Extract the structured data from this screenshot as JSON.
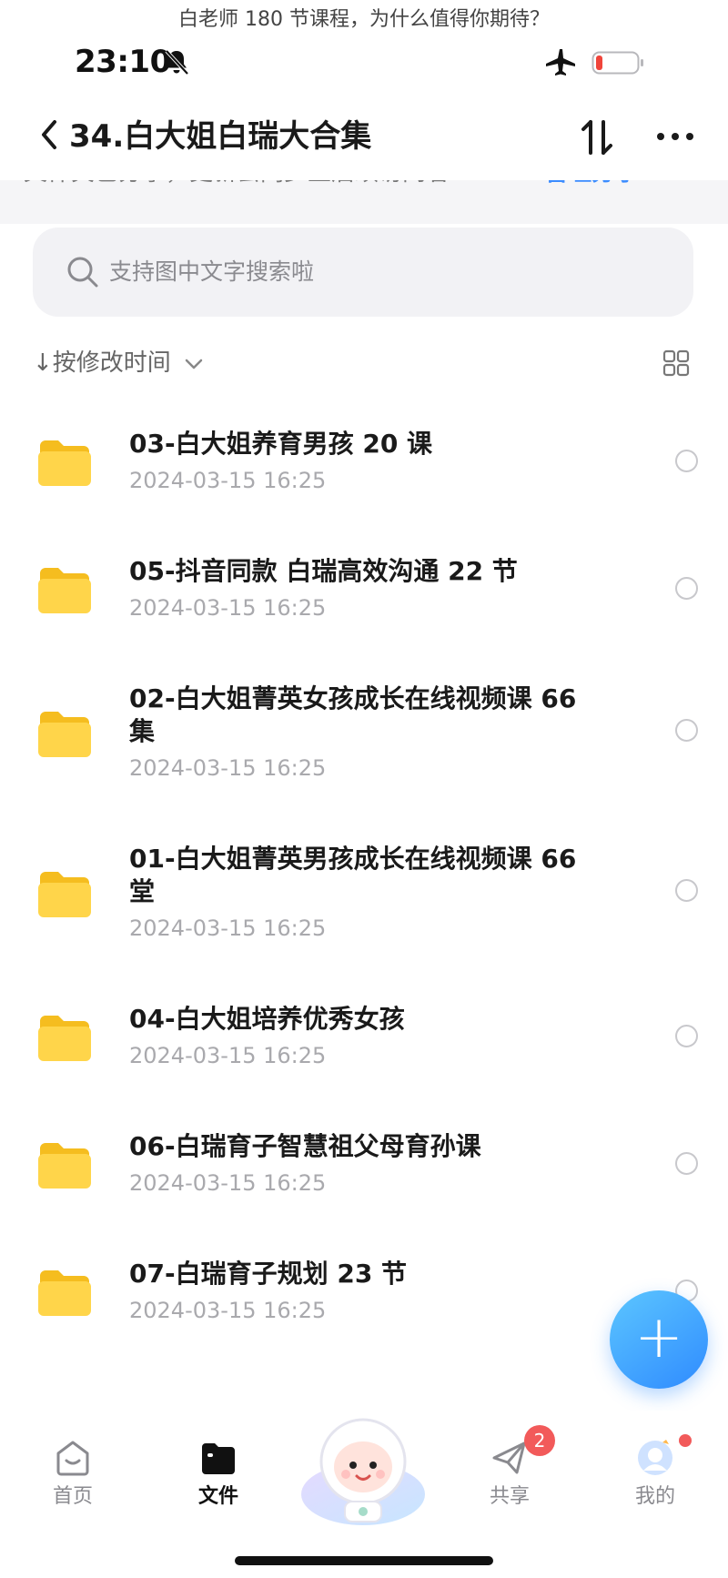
{
  "caption": "白老师 180 节课程，为什么值得你期待？",
  "status_bar": {
    "time": "23:10"
  },
  "header": {
    "title": "34.白大姐白瑞大合集"
  },
  "notice": {
    "text": "文件夹已分享，更新会同步至后续访问者",
    "action": "管理分享"
  },
  "search": {
    "placeholder": "支持图中文字搜索啦"
  },
  "sort": {
    "label": "↓按修改时间"
  },
  "files": [
    {
      "name": "03-白大姐养育男孩 20 课",
      "date": "2024-03-15 16:25"
    },
    {
      "name": "05-抖音同款 白瑞高效沟通 22 节",
      "date": "2024-03-15 16:25"
    },
    {
      "name": "02-白大姐菁英女孩成长在线视频课 66 集",
      "date": "2024-03-15 16:25"
    },
    {
      "name": "01-白大姐菁英男孩成长在线视频课 66 堂",
      "date": "2024-03-15 16:25"
    },
    {
      "name": "04-白大姐培养优秀女孩",
      "date": "2024-03-15 16:25"
    },
    {
      "name": "06-白瑞育子智慧祖父母育孙课",
      "date": "2024-03-15 16:25"
    },
    {
      "name": "07-白瑞育子规划 23 节",
      "date": "2024-03-15 16:25"
    }
  ],
  "tabbar": {
    "home": "首页",
    "files": "文件",
    "share": "共享",
    "share_badge": "2",
    "me": "我的"
  },
  "colors": {
    "accent": "#2f8bff",
    "folder": "#ffd54a",
    "badge": "#f25a5a"
  },
  "icons": [
    "bell-slash-icon",
    "airplane-icon",
    "battery-icon",
    "back-icon",
    "sort-icon",
    "more-icon",
    "search-icon",
    "grid-icon",
    "folder-icon",
    "plus-icon",
    "home-icon",
    "files-icon",
    "share-icon",
    "profile-icon"
  ]
}
